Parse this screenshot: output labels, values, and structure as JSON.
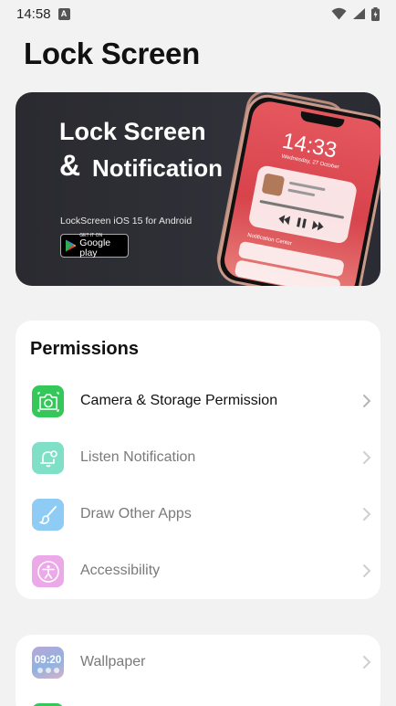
{
  "status_bar": {
    "time": "14:58",
    "notification_badge": "A"
  },
  "page": {
    "title": "Lock Screen"
  },
  "banner": {
    "title_line1": "Lock Screen",
    "title_amp": "&",
    "title_line2": "Notification",
    "subtitle": "LockScreen iOS 15 for Android",
    "store_badge_small": "GET IT ON",
    "store_badge_big": "Google play",
    "phone_time": "14:33",
    "phone_date": "Wednesday, 27 October",
    "phone_notif_title": "Notification Center"
  },
  "permissions": {
    "title": "Permissions",
    "items": [
      {
        "label": "Camera & Storage Permission",
        "icon": "camera-icon",
        "color": "#34c759",
        "enabled": true
      },
      {
        "label": "Listen Notification",
        "icon": "bell-icon",
        "color": "#7fe0c7",
        "enabled": false
      },
      {
        "label": "Draw Other Apps",
        "icon": "brush-icon",
        "color": "#8ecbf5",
        "enabled": false
      },
      {
        "label": "Accessibility",
        "icon": "accessibility-icon",
        "color": "#eca9e8",
        "enabled": false
      }
    ]
  },
  "more": {
    "items": [
      {
        "label": "Wallpaper",
        "icon": "wallpaper-icon",
        "icon_text": "09:20"
      }
    ]
  },
  "colors": {
    "background": "#f2f2f2",
    "card": "#ffffff",
    "active_text": "#111111",
    "inactive_text": "#7a7a7a",
    "chevron": "#b5b5b5"
  }
}
